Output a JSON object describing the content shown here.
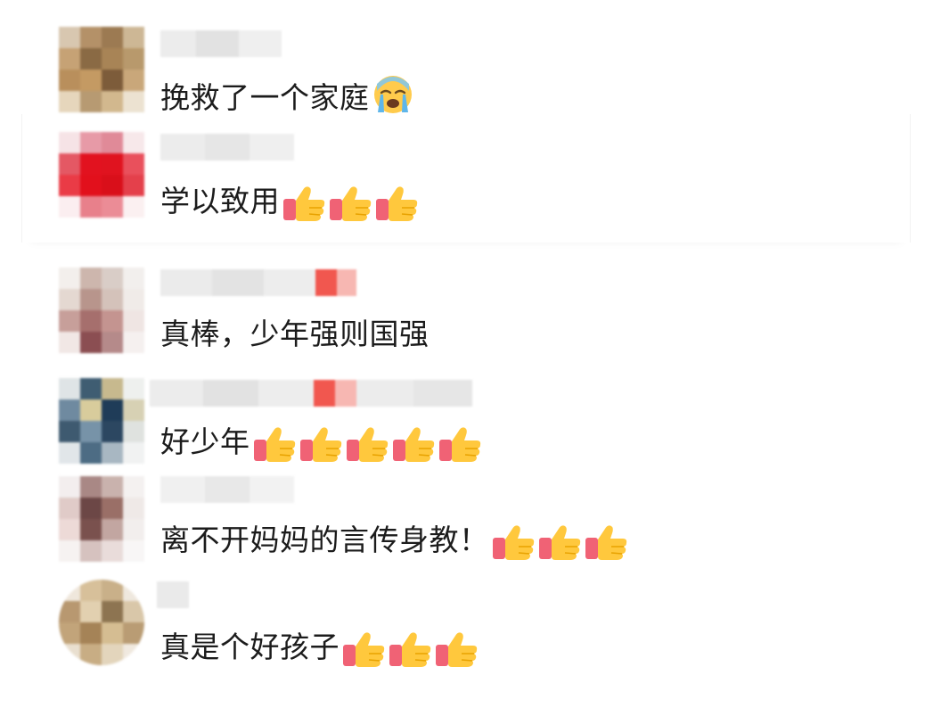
{
  "comments": [
    {
      "text": "挽救了一个家庭",
      "emoji": "loudly-crying-face",
      "thumbs": 0
    },
    {
      "text": "学以致用",
      "emoji": "",
      "thumbs": 3
    },
    {
      "text": "真棒，少年强则国强",
      "emoji": "",
      "thumbs": 0
    },
    {
      "text": "好少年",
      "emoji": "",
      "thumbs": 5
    },
    {
      "text": "离不开妈妈的言传身教！",
      "emoji": "",
      "thumbs": 3
    },
    {
      "text": "真是个好孩子",
      "emoji": "",
      "thumbs": 3
    }
  ],
  "icons": {
    "thumbs_up": "thumbs-up-icon",
    "crying": "loudly-crying-face-icon"
  },
  "colors": {
    "text": "#1c1c1c",
    "thumb_hand": "#FFC83D",
    "thumb_cuff": "#F06275"
  }
}
